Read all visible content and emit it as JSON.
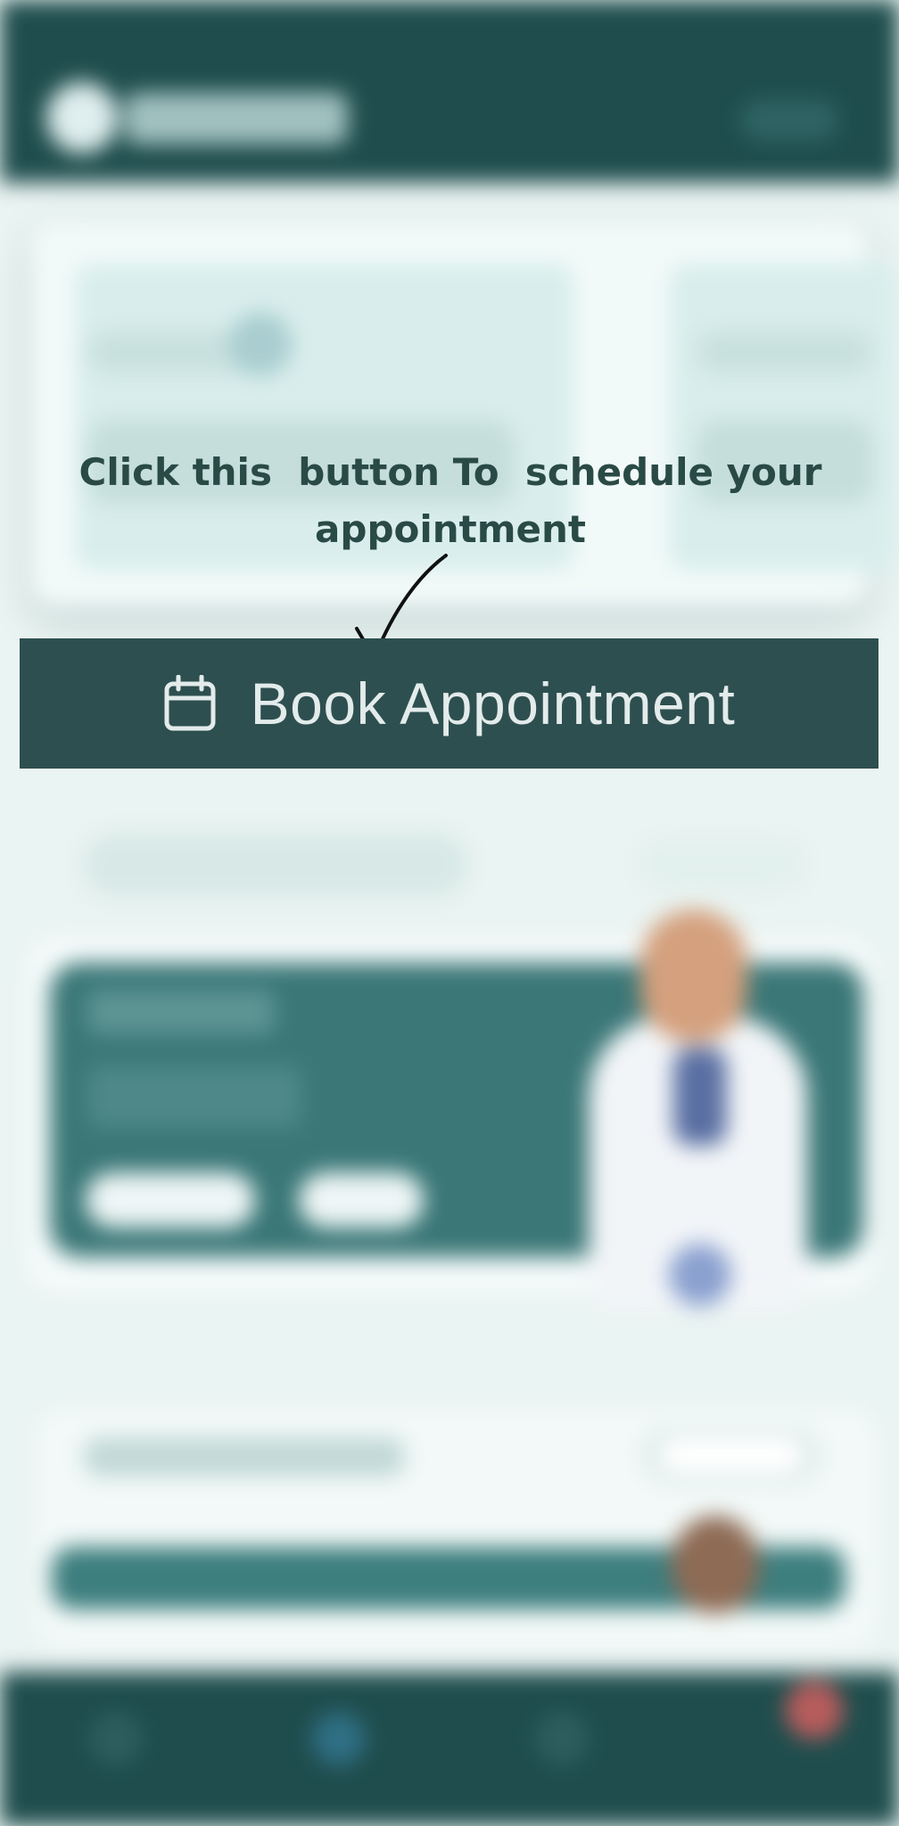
{
  "overlay": {
    "hint_line1": "Click this  button To  schedule your",
    "hint_line2": "appointment"
  },
  "book_button": {
    "label": "Book Appointment",
    "icon": "calendar-icon"
  },
  "colors": {
    "header_bg": "#1f4d4d",
    "button_bg": "#2e4f4f",
    "button_text": "#e3ebeb",
    "page_bg": "#eaf4f2",
    "promo_bg": "#3b7777",
    "hint_text": "#2a4a46"
  }
}
